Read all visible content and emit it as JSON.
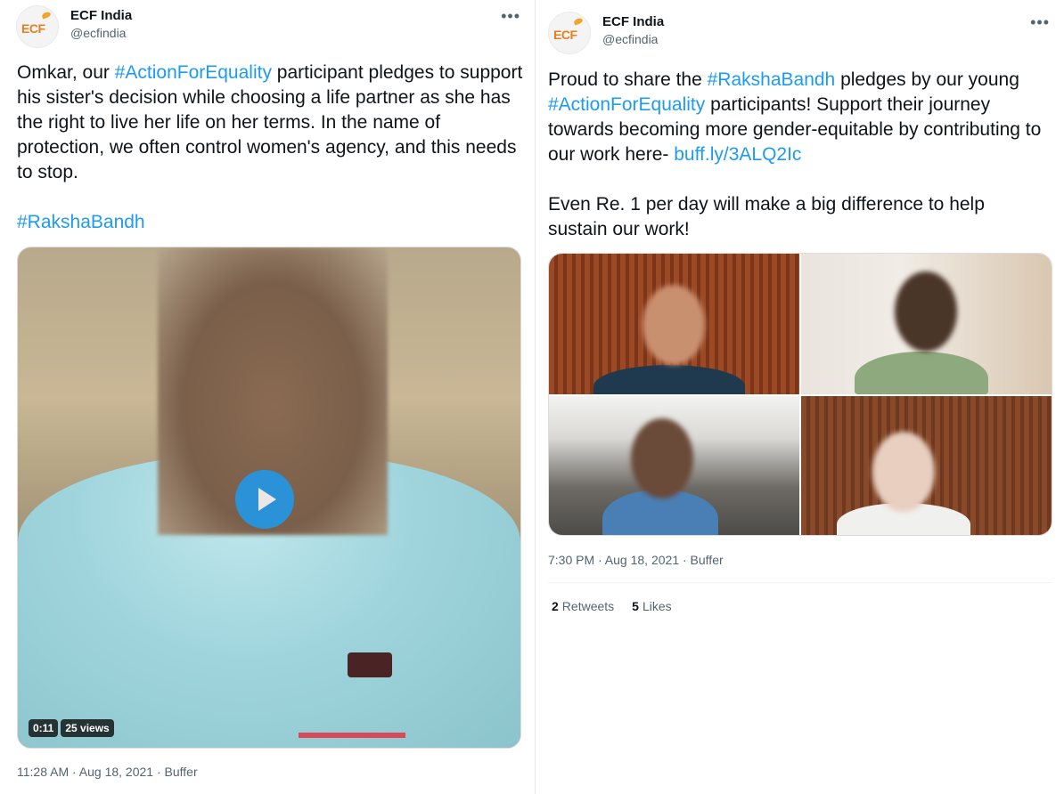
{
  "tweets": [
    {
      "author_name": "ECF India",
      "author_handle": "@ecfindia",
      "avatar_text": "ECF",
      "more_icon": "more-horizontal-icon",
      "text_segments": [
        {
          "t": "Omkar, our ",
          "link": false
        },
        {
          "t": "#ActionForEquality",
          "link": true
        },
        {
          "t": " participant pledges to support his sister's decision while choosing a life partner as she has the right to live her life on her terms. In the name of protection, we often control women's agency, and this needs to stop.\n\n",
          "link": false
        },
        {
          "t": "#RakshaBandh",
          "link": true
        }
      ],
      "video": {
        "duration": "0:11",
        "views": "25 views"
      },
      "timestamp": "11:28 AM · Aug 18, 2021 · Buffer"
    },
    {
      "author_name": "ECF India",
      "author_handle": "@ecfindia",
      "avatar_text": "ECF",
      "more_icon": "more-horizontal-icon",
      "text_segments": [
        {
          "t": "Proud to share the ",
          "link": false
        },
        {
          "t": "#RakshaBandh",
          "link": true
        },
        {
          "t": " pledges by our young ",
          "link": false
        },
        {
          "t": "#ActionForEquality",
          "link": true
        },
        {
          "t": " participants! Support their journey towards becoming more gender-equitable by contributing to our work here- ",
          "link": false
        },
        {
          "t": "buff.ly/3ALQ2Ic",
          "link": true
        },
        {
          "t": "\n\nEven Re. 1 per day will make a big difference to help sustain our work!",
          "link": false
        }
      ],
      "timestamp": "7:30 PM · Aug 18, 2021 · Buffer",
      "stats": {
        "retweets_count": "2",
        "retweets_label": "Retweets",
        "likes_count": "5",
        "likes_label": "Likes"
      }
    }
  ],
  "colors": {
    "link": "#1d9bf0",
    "text": "#0f1419",
    "secondary": "#536471",
    "logo_orange": "#e87d1e"
  }
}
